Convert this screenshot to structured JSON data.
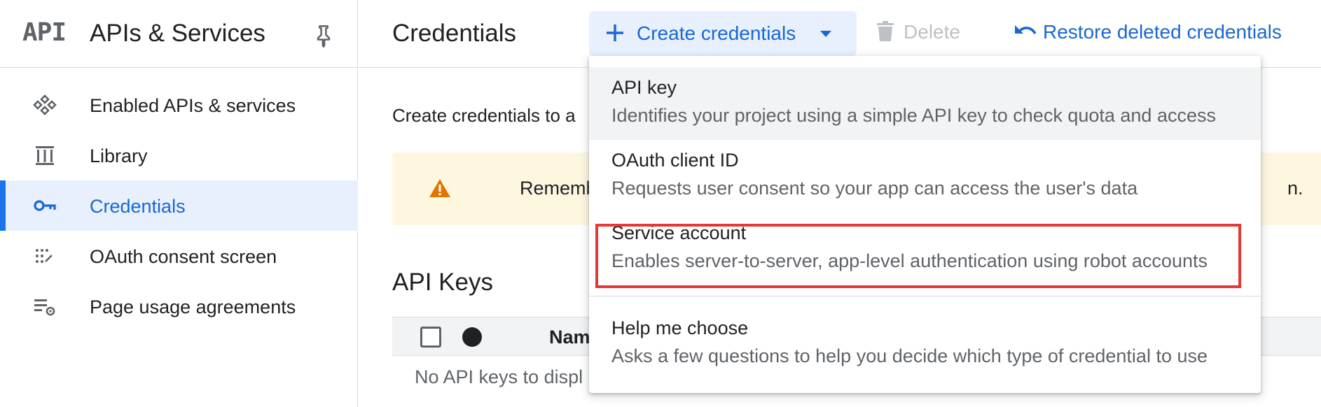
{
  "sidebar": {
    "logo": "API",
    "title": "APIs & Services",
    "items": [
      {
        "label": "Enabled APIs & services",
        "icon": "enabled-apis-icon",
        "active": false
      },
      {
        "label": "Library",
        "icon": "library-icon",
        "active": false
      },
      {
        "label": "Credentials",
        "icon": "key-icon",
        "active": true
      },
      {
        "label": "OAuth consent screen",
        "icon": "oauth-consent-icon",
        "active": false
      },
      {
        "label": "Page usage agreements",
        "icon": "settings-list-icon",
        "active": false
      }
    ]
  },
  "header": {
    "title": "Credentials",
    "create_label": "Create credentials",
    "delete_label": "Delete",
    "restore_label": "Restore deleted credentials"
  },
  "main": {
    "intro_text": "Create credentials to a",
    "warning_text": "Remember t",
    "warning_tail": "n.",
    "api_keys_title": "API Keys",
    "table_name_header": "Name",
    "empty_text": "No API keys to displ"
  },
  "dropdown": {
    "items": [
      {
        "title": "API key",
        "description": "Identifies your project using a simple API key to check quota and access"
      },
      {
        "title": "OAuth client ID",
        "description": "Requests user consent so your app can access the user's data"
      },
      {
        "title": "Service account",
        "description": "Enables server-to-server, app-level authentication using robot accounts"
      },
      {
        "title": "Help me choose",
        "description": "Asks a few questions to help you decide which type of credential to use"
      }
    ]
  },
  "colors": {
    "accent": "#1967d2",
    "active_bg": "#e8f0fe",
    "warning_bg": "#fef7e0",
    "warning_icon": "#e37400",
    "highlight": "#e53935"
  }
}
